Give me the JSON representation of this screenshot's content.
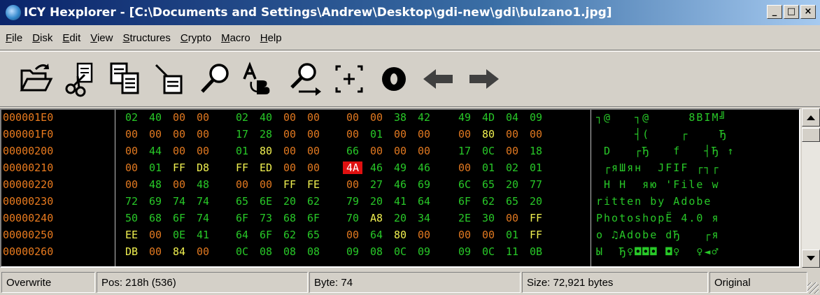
{
  "window": {
    "title": "ICY Hexplorer - [C:\\Documents and Settings\\Andrew\\Desktop\\gdi-new\\gdi\\bulzano1.jpg]",
    "minimize": "_",
    "maximize": "□",
    "close": "×"
  },
  "menu": [
    {
      "key": "F",
      "rest": "ile"
    },
    {
      "key": "D",
      "rest": "isk"
    },
    {
      "key": "E",
      "rest": "dit"
    },
    {
      "key": "V",
      "rest": "iew"
    },
    {
      "key": "S",
      "rest": "tructures"
    },
    {
      "key": "C",
      "rest": "rypto"
    },
    {
      "key": "M",
      "rest": "acro"
    },
    {
      "key": "H",
      "rest": "elp"
    }
  ],
  "toolbar": [
    {
      "name": "open-file-icon"
    },
    {
      "name": "cut-icon"
    },
    {
      "name": "copy-icon"
    },
    {
      "name": "paste-icon"
    },
    {
      "name": "find-icon"
    },
    {
      "name": "replace-icon"
    },
    {
      "name": "find-next-icon"
    },
    {
      "name": "goto-icon"
    },
    {
      "name": "stop-icon"
    },
    {
      "name": "back-arrow-icon"
    },
    {
      "name": "forward-arrow-icon"
    }
  ],
  "hex_rows": [
    {
      "addr": "000001E0",
      "bytes": [
        "02",
        "40",
        "00",
        "00",
        "02",
        "40",
        "00",
        "00",
        "00",
        "00",
        "38",
        "42",
        "49",
        "4D",
        "04",
        "09"
      ],
      "ascii": "┐@   ┐@     8BIM╝"
    },
    {
      "addr": "000001F0",
      "bytes": [
        "00",
        "00",
        "00",
        "00",
        "17",
        "28",
        "00",
        "00",
        "00",
        "01",
        "00",
        "00",
        "00",
        "80",
        "00",
        "00"
      ],
      "ascii": "     ┤(    ┌    Ђ "
    },
    {
      "addr": "00000200",
      "bytes": [
        "00",
        "44",
        "00",
        "00",
        "01",
        "80",
        "00",
        "00",
        "66",
        "00",
        "00",
        "00",
        "17",
        "0C",
        "00",
        "18"
      ],
      "ascii": " D   ┌Ђ   f   ┤Ђ ↑"
    },
    {
      "addr": "00000210",
      "bytes": [
        "00",
        "01",
        "FF",
        "D8",
        "FF",
        "ED",
        "00",
        "00",
        "4A",
        "46",
        "49",
        "46",
        "00",
        "01",
        "02",
        "01"
      ],
      "ascii": " ┌яШян  JFIF ┌┐┌"
    },
    {
      "addr": "00000220",
      "bytes": [
        "00",
        "48",
        "00",
        "48",
        "00",
        "00",
        "FF",
        "FE",
        "00",
        "27",
        "46",
        "69",
        "6C",
        "65",
        "20",
        "77"
      ],
      "ascii": " H H  яю 'File w"
    },
    {
      "addr": "00000230",
      "bytes": [
        "72",
        "69",
        "74",
        "74",
        "65",
        "6E",
        "20",
        "62",
        "79",
        "20",
        "41",
        "64",
        "6F",
        "62",
        "65",
        "20"
      ],
      "ascii": "ritten by Adobe "
    },
    {
      "addr": "00000240",
      "bytes": [
        "50",
        "68",
        "6F",
        "74",
        "6F",
        "73",
        "68",
        "6F",
        "70",
        "A8",
        "20",
        "34",
        "2E",
        "30",
        "00",
        "FF"
      ],
      "ascii": "PhotoshopЁ 4.0 я"
    },
    {
      "addr": "00000250",
      "bytes": [
        "EE",
        "00",
        "0E",
        "41",
        "64",
        "6F",
        "62",
        "65",
        "00",
        "64",
        "80",
        "00",
        "00",
        "00",
        "01",
        "FF"
      ],
      "ascii": "о ♫Adobe dЂ   ┌я"
    },
    {
      "addr": "00000260",
      "bytes": [
        "DB",
        "00",
        "84",
        "00",
        "0C",
        "08",
        "08",
        "08",
        "09",
        "08",
        "0C",
        "09",
        "09",
        "0C",
        "11",
        "0B"
      ],
      "ascii": "Ы  Ђ♀◘◘◘ ◘♀  ♀◄♂"
    }
  ],
  "selected_cell": {
    "row": 3,
    "col": 8
  },
  "status": {
    "mode": "Overwrite",
    "position": "Pos: 218h (536)",
    "byte": "Byte: 74",
    "size": "Size: 72,921 bytes",
    "state": "Original"
  },
  "colors": {
    "zero_byte": "#e07820",
    "nonzero_byte": "#28c828",
    "high_byte": "#f0f050",
    "address": "#e87a1e",
    "selection": "#e01010"
  }
}
